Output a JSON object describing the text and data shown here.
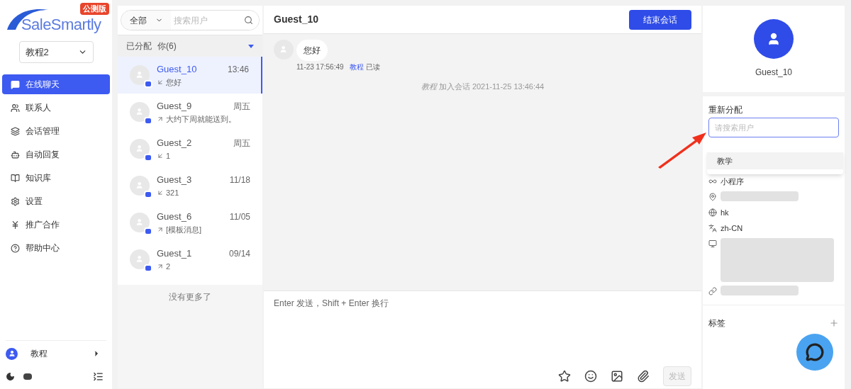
{
  "brand": {
    "logo": "SaleSmartly",
    "badge": "公测版"
  },
  "workspace": {
    "value": "教程2"
  },
  "nav": [
    {
      "label": "在线聊天",
      "kind": "chat",
      "selected": true
    },
    {
      "label": "联系人",
      "kind": "contacts",
      "selected": false
    },
    {
      "label": "会话管理",
      "kind": "layers",
      "selected": false
    },
    {
      "label": "自动回复",
      "kind": "robot",
      "selected": false
    },
    {
      "label": "知识库",
      "kind": "book",
      "selected": false
    },
    {
      "label": "设置",
      "kind": "settings",
      "selected": false
    },
    {
      "label": "推广合作",
      "kind": "yen",
      "selected": false
    },
    {
      "label": "帮助中心",
      "kind": "help",
      "selected": false
    }
  ],
  "user": {
    "name": "教程"
  },
  "conversation_list": {
    "filter": "全部",
    "search_placeholder": "搜索用户",
    "group": "已分配",
    "group_count": "你(6)",
    "items": [
      {
        "name": "Guest_10",
        "time": "13:46",
        "preview": "您好",
        "kind": "in",
        "selected": true
      },
      {
        "name": "Guest_9",
        "time": "周五",
        "preview": "大约下周就能送到。",
        "kind": "out",
        "selected": false
      },
      {
        "name": "Guest_2",
        "time": "周五",
        "preview": "1",
        "kind": "in",
        "selected": false
      },
      {
        "name": "Guest_3",
        "time": "11/18",
        "preview": "321",
        "kind": "in",
        "selected": false
      },
      {
        "name": "Guest_6",
        "time": "11/05",
        "preview": "[模板消息]",
        "kind": "out",
        "selected": false
      },
      {
        "name": "Guest_1",
        "time": "09/14",
        "preview": "2",
        "kind": "out",
        "selected": false
      }
    ],
    "footer": "没有更多了"
  },
  "chat": {
    "title": "Guest_10",
    "end_button": "结束会话",
    "message": {
      "text": "您好",
      "time": "11-23 17:56:49",
      "agent": "教程",
      "status": "已读"
    },
    "event": {
      "actor": "教程",
      "text": "加入会话 2021-11-25 13:46:44"
    },
    "input_placeholder": "Enter 发送，Shift + Enter 换行",
    "send_button": "发送",
    "send_disabled": true
  },
  "profile": {
    "name": "Guest_10",
    "reassign_label": "重新分配",
    "reassign_placeholder": "请搜索用户",
    "dropdown_options": [
      "教学"
    ],
    "details": [
      {
        "kind": "miniprogram",
        "text": "小程序"
      },
      {
        "kind": "ip",
        "redacted": true
      },
      {
        "kind": "globe",
        "text": "hk"
      },
      {
        "kind": "language",
        "text": "zh-CN"
      },
      {
        "kind": "device",
        "redacted": true
      },
      {
        "kind": "link",
        "redacted": true
      }
    ],
    "tags_label": "标签"
  }
}
